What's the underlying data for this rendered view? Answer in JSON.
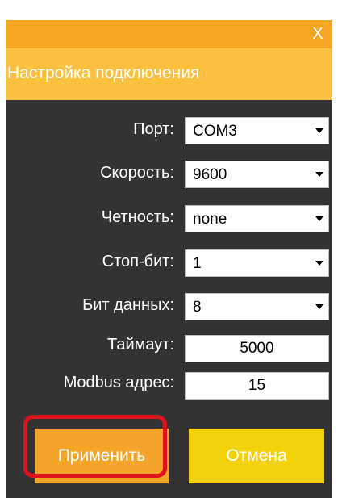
{
  "window": {
    "close_label": "X",
    "title": "Настройка подключения"
  },
  "form": {
    "port_label": "Порт:",
    "port_value": "COM3",
    "speed_label": "Скорость:",
    "speed_value": "9600",
    "parity_label": "Четность:",
    "parity_value": "none",
    "stopbits_label": "Стоп-бит:",
    "stopbits_value": "1",
    "databits_label": "Бит данных:",
    "databits_value": "8",
    "timeout_label": "Таймаут:",
    "timeout_value": "5000",
    "modbus_label": "Modbus адрес:",
    "modbus_value": "15"
  },
  "buttons": {
    "apply_label": "Применить",
    "cancel_label": "Отмена"
  },
  "colors": {
    "titlebar": "#f5a623",
    "header": "#fbc040",
    "panel": "#333333",
    "apply": "#f5a42a",
    "cancel": "#f2d20a",
    "highlight": "#e0101d"
  }
}
